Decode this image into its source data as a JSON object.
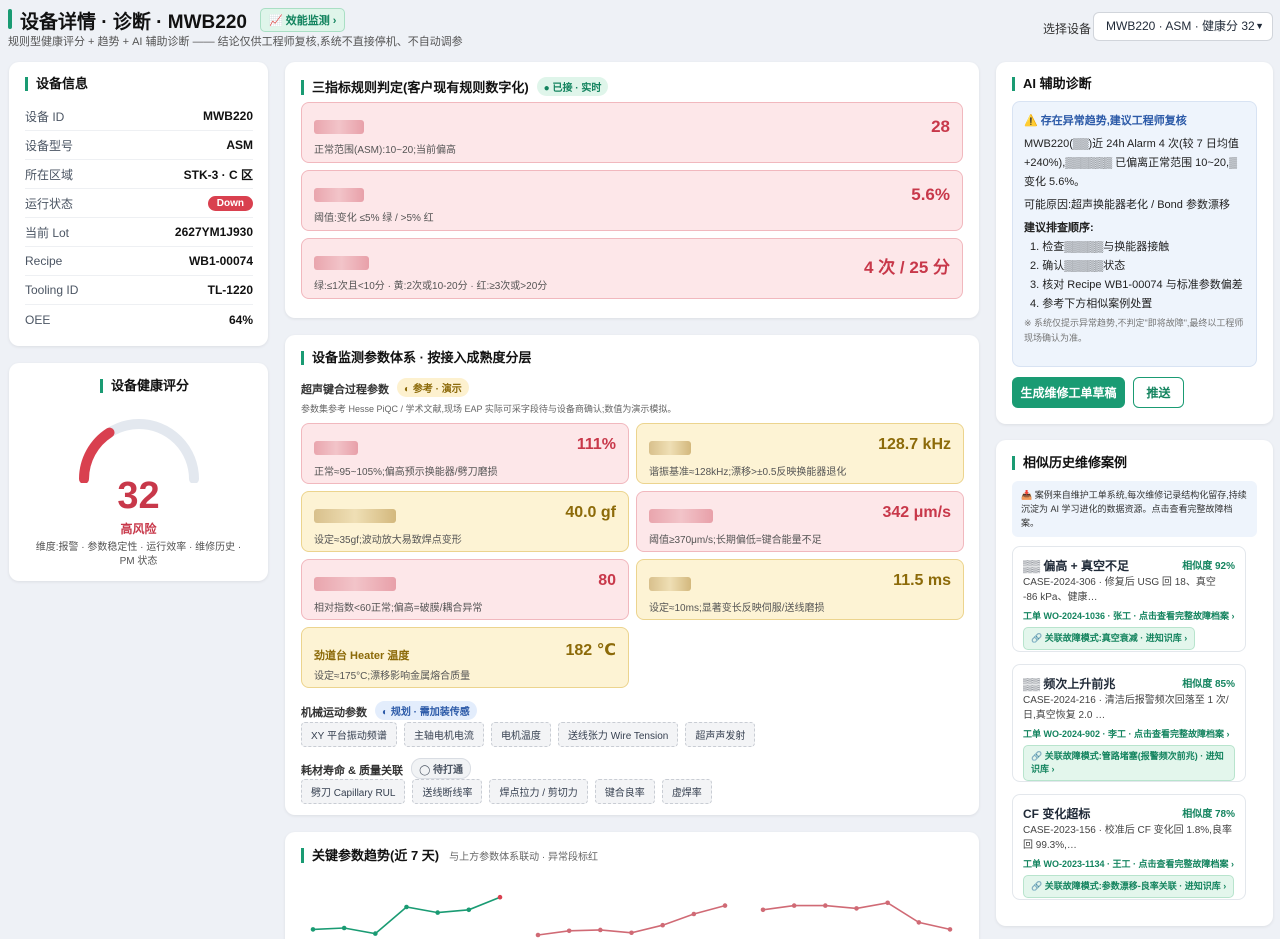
{
  "header": {
    "title": "设备详情 · 诊断 · MWB220",
    "badge": "📈 效能监测 ›",
    "subtitle": "规则型健康评分 + 趋势 + AI 辅助诊断 —— 结论仅供工程师复核,系统不直接停机、不自动调参",
    "select_label": "选择设备",
    "select_value": "MWB220 · ASM · 健康分 32"
  },
  "device_info": {
    "title": "设备信息",
    "rows": [
      {
        "k": "设备 ID",
        "v": "MWB220"
      },
      {
        "k": "设备型号",
        "v": "ASM"
      },
      {
        "k": "所在区域",
        "v": "STK-3 · C 区"
      },
      {
        "k": "运行状态",
        "v": "Down"
      },
      {
        "k": "当前 Lot",
        "v": "2627YM1J930"
      },
      {
        "k": "Recipe",
        "v": "WB1-00074"
      },
      {
        "k": "Tooling ID",
        "v": "TL-1220"
      },
      {
        "k": "OEE",
        "v": "64%"
      }
    ]
  },
  "health": {
    "title": "设备健康评分",
    "score": "32",
    "score_value": 32,
    "level": "高风险",
    "dims": "维度:报警 · 参数稳定性 · 运行效率 · 维修历史 · PM 状态"
  },
  "rules": {
    "title": "三指标规则判定(客户现有规则数字化)",
    "badge": "● 已接 · 实时",
    "items": [
      {
        "value": "28",
        "desc": "正常范围(ASM):10~20;当前偏高"
      },
      {
        "value": "5.6%",
        "desc": "阈值:变化 ≤5% 绿 / >5% 红"
      },
      {
        "value": "4 次 / 25 分",
        "desc": "绿:≤1次且<10分 · 黄:2次或10-20分 · 红:≥3次或>20分"
      }
    ]
  },
  "monitor": {
    "title": "设备监测参数体系 · 按接入成熟度分层",
    "ultra_title": "超声键合过程参数",
    "ultra_badge": "◐ 参考 · 演示",
    "ultra_note": "参数集参考 Hesse PiQC / 学术文献,现场 EAP 实际可采字段待与设备商确认;数值为演示模拟。",
    "params": [
      {
        "value": "111%",
        "desc": "正常≈95~105%;偏高预示换能器/劈刀磨损",
        "tone": "r"
      },
      {
        "value": "128.7 kHz",
        "desc": "谐振基准≈128kHz;漂移>±0.5反映换能器退化",
        "tone": "y"
      },
      {
        "value": "40.0 gf",
        "desc": "设定≈35gf;波动放大易致焊点变形",
        "tone": "y"
      },
      {
        "value": "342 μm/s",
        "desc": "阈值≥370μm/s;长期偏低=键合能量不足",
        "tone": "r"
      },
      {
        "value": "80",
        "desc": "相对指数<60正常;偏高=破膜/耦合异常",
        "tone": "r"
      },
      {
        "value": "11.5 ms",
        "desc": "设定≈10ms;显著变长反映伺服/送线磨损",
        "tone": "y"
      },
      {
        "name": "劲道台 Heater 温度",
        "value": "182 ℃",
        "desc": "设定≈175°C;漂移影响金属熔合质量",
        "tone": "y"
      }
    ],
    "mech_title": "机械运动参数",
    "mech_badge": "◐ 规划 · 需加装传感",
    "mech_chips": [
      "XY 平台振动频谱",
      "主轴电机电流",
      "电机温度",
      "送线张力 Wire Tension",
      "超声声发射"
    ],
    "cons_title": "耗材寿命 & 质量关联",
    "cons_badge": "◯ 待打通",
    "cons_chips": [
      "劈刀 Capillary RUL",
      "送线断线率",
      "焊点拉力 / 剪切力",
      "键合良率",
      "虚焊率"
    ]
  },
  "trend": {
    "title": "关键参数趋势(近 7 天)",
    "note": "与上方参数体系联动 · 异常段标红"
  },
  "ai": {
    "title": "AI 辅助诊断",
    "alert": "⚠️ 存在异常趋势,建议工程师复核",
    "p1": "MWB220(▒▒)近 24h Alarm 4 次(较 7 日均值 +240%),▒▒▒▒▒▒ 已偏离正常范围 10~20,▒ 变化 5.6%。",
    "p2": "可能原因:超声换能器老化 / Bond 参数漂移",
    "steps_title": "建议排查顺序:",
    "steps": [
      "1. 检查▒▒▒▒▒与换能器接触",
      "2. 确认▒▒▒▒▒状态",
      "3. 核对 Recipe WB1-00074 与标准参数偏差",
      "4. 参考下方相似案例处置"
    ],
    "note": "※ 系统仅提示异常趋势,不判定\"即将故障\",最终以工程师现场确认为准。",
    "btn_primary": "生成维修工单草稿",
    "btn_secondary": "推送"
  },
  "cases": {
    "title": "相似历史维修案例",
    "intro": "📥 案例来自维护工单系统,每次维修记录结构化留存,持续沉淀为 AI 学习进化的数据资源。点击查看完整故障档案。",
    "items": [
      {
        "title": "▒▒ 偏高 + 真空不足",
        "sim": "相似度 92%",
        "desc": "CASE-2024-306 · 修复后 USG 回 18、真空 -86 kPa、健康…",
        "wo": "工单 WO-2024-1036 · 张工 · 点击查看完整故障档案 ›",
        "fm": "🔗 关联故障模式:真空衰减 · 进知识库 ›"
      },
      {
        "title": "▒▒ 频次上升前兆",
        "sim": "相似度 85%",
        "desc": "CASE-2024-216 · 清洁后报警频次回落至 1 次/日,真空恢复 2.0 …",
        "wo": "工单 WO-2024-902 · 李工 · 点击查看完整故障档案 ›",
        "fm": "🔗 关联故障模式:管路堵塞(报警频次前兆) · 进知识库 ›"
      },
      {
        "title": "CF 变化超标",
        "sim": "相似度 78%",
        "desc": "CASE-2023-156 · 校准后 CF 变化回 1.8%,良率回 99.3%,…",
        "wo": "工单 WO-2023-1134 · 王工 · 点击查看完整故障档案 ›",
        "fm": "🔗 关联故障模式:参数漂移-良率关联 · 进知识库 ›"
      }
    ]
  },
  "chart_data": {
    "type": "line",
    "series": [
      {
        "values": [
          0.2,
          0.25,
          0.05,
          1.0,
          0.8,
          0.9,
          1.35
        ],
        "color": "#1a9b73"
      },
      {
        "values": [
          0.0,
          0.15,
          0.18,
          0.08,
          0.35,
          0.75,
          1.05
        ],
        "color": "#d06a75"
      },
      {
        "values": [
          0.9,
          1.05,
          1.05,
          0.95,
          1.15,
          0.45,
          0.2
        ],
        "color": "#d06a75"
      }
    ]
  }
}
